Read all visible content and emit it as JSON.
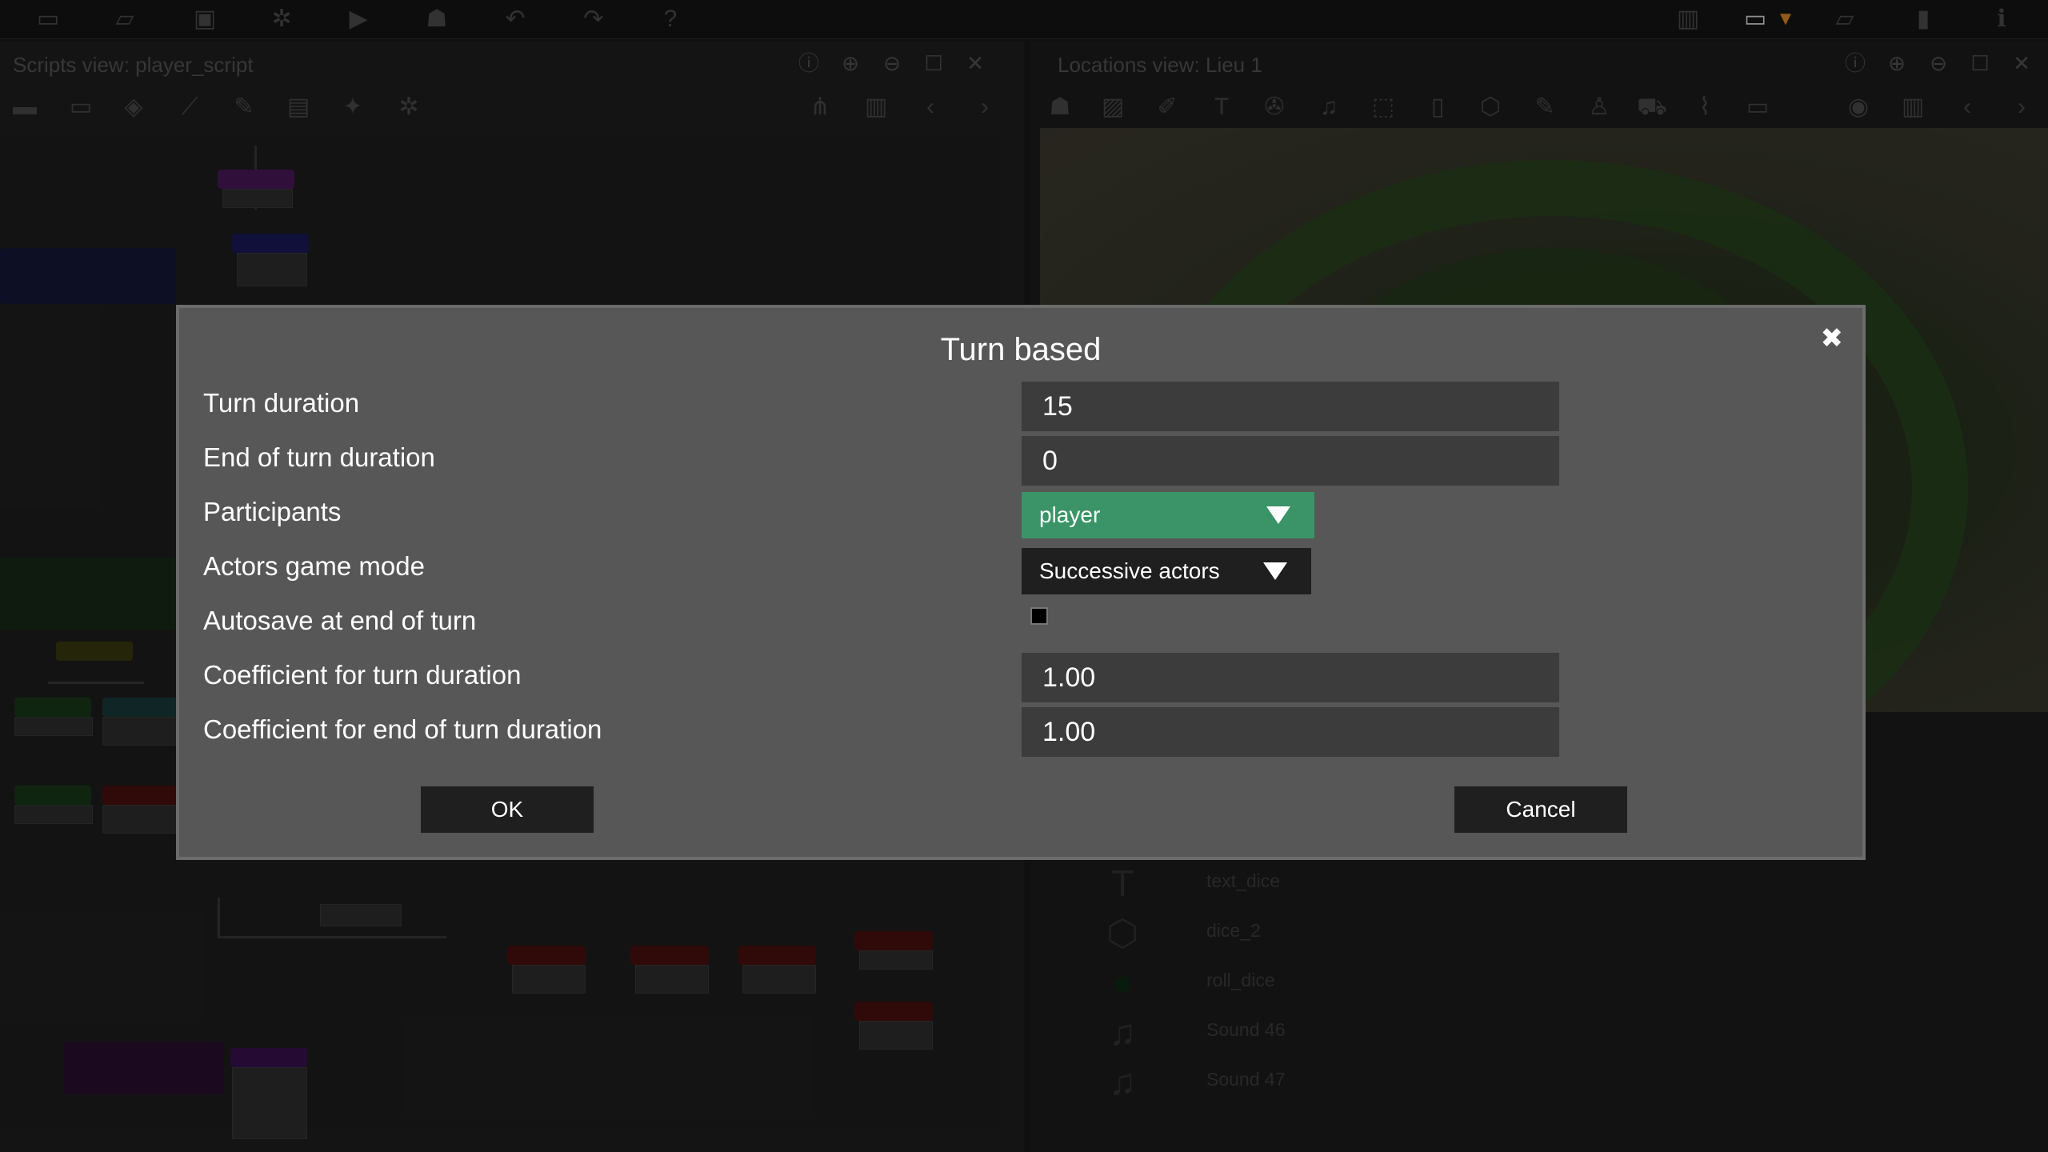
{
  "scripts_panel": {
    "title": "Scripts view: player_script"
  },
  "locations_panel": {
    "title": "Locations view: Lieu 1"
  },
  "objects_list": [
    {
      "label": "text_dice",
      "icon": "text-icon"
    },
    {
      "label": "dice_2",
      "icon": "3d-icon"
    },
    {
      "label": "roll_dice",
      "icon": "ellipse-icon"
    },
    {
      "label": "Sound 46",
      "icon": "music-note-icon"
    },
    {
      "label": "Sound 47",
      "icon": "music-note-icon"
    }
  ],
  "dialog": {
    "title": "Turn based",
    "fields": {
      "turn_duration": {
        "label": "Turn duration",
        "value": "15"
      },
      "end_of_turn_duration": {
        "label": "End of turn duration",
        "value": "0"
      },
      "participants": {
        "label": "Participants",
        "value": "player"
      },
      "actors_game_mode": {
        "label": "Actors game mode",
        "value": "Successive actors"
      },
      "autosave": {
        "label": "Autosave at end of turn",
        "checked": false
      },
      "coef_turn_duration": {
        "label": "Coefficient for turn duration",
        "value": "1.00"
      },
      "coef_end_turn_duration": {
        "label": "Coefficient for end of turn duration",
        "value": "1.00"
      }
    },
    "ok_label": "OK",
    "cancel_label": "Cancel"
  },
  "colors": {
    "dialog_bg": "#575757",
    "participants_accent": "#3a9467",
    "input_bg": "#3c3c3c"
  }
}
